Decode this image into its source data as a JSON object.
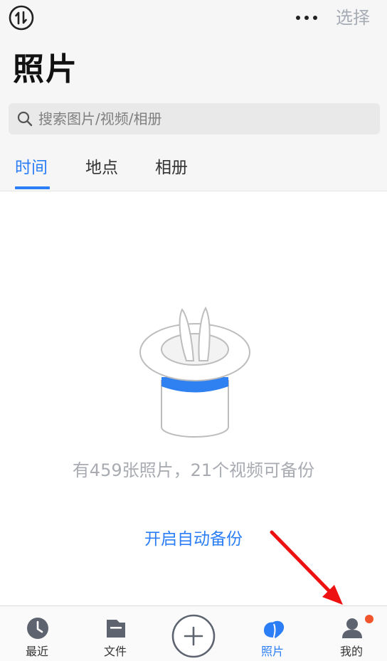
{
  "header": {
    "title": "照片",
    "select_label": "选择",
    "transfer_icon": "transfer-icon",
    "more_icon": "more-icon"
  },
  "search": {
    "placeholder": "搜索图片/视频/相册"
  },
  "tabs": [
    {
      "label": "时间",
      "active": true
    },
    {
      "label": "地点",
      "active": false
    },
    {
      "label": "相册",
      "active": false
    }
  ],
  "empty_state": {
    "illustration": "magic-hat-with-bunny-ears",
    "message": "有459张照片，21个视频可备份",
    "action_label": "开启自动备份"
  },
  "tabbar": {
    "items": [
      {
        "label": "最近",
        "icon": "clock-icon",
        "active": false
      },
      {
        "label": "文件",
        "icon": "folder-icon",
        "active": false
      },
      {
        "label": "",
        "icon": "plus-icon",
        "active": false
      },
      {
        "label": "照片",
        "icon": "photos-icon",
        "active": true
      },
      {
        "label": "我的",
        "icon": "profile-icon",
        "active": false,
        "badge": true
      }
    ]
  },
  "colors": {
    "accent": "#2b7ef5",
    "badge": "#f2552c",
    "arrow": "#ee1111",
    "muted_text": "#a8abb1"
  }
}
